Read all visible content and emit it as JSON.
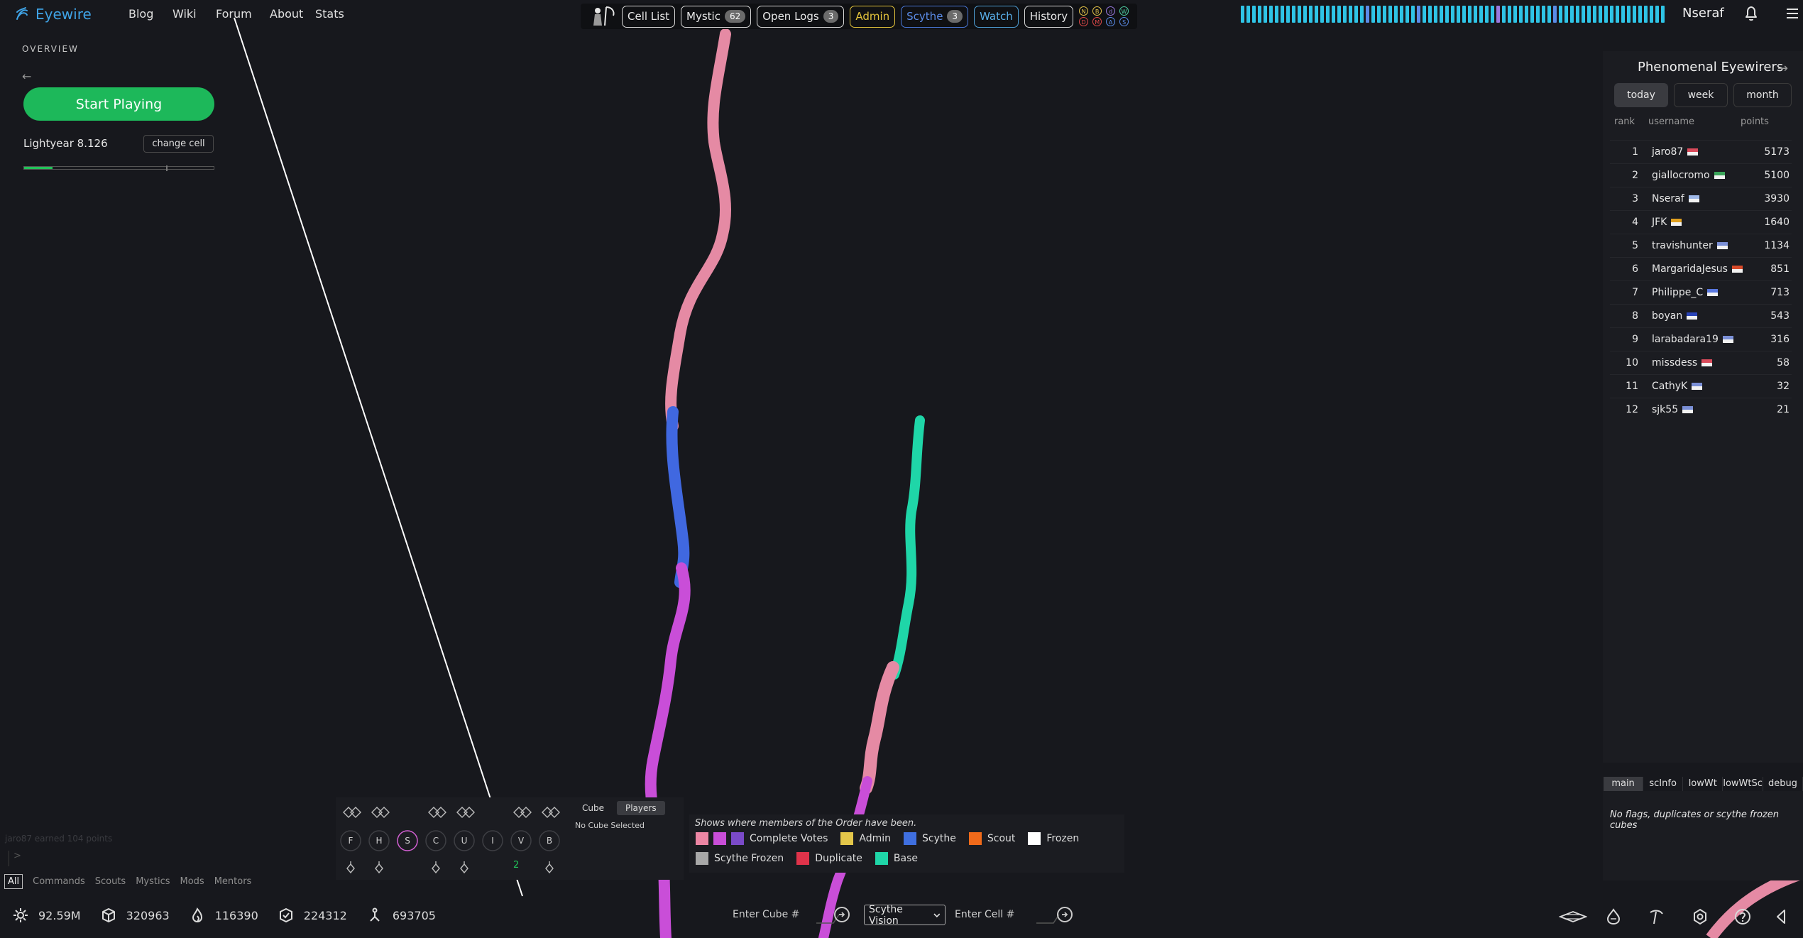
{
  "header": {
    "brand": "Eyewire",
    "nav": [
      "Blog",
      "Wiki",
      "Forum",
      "About",
      "Stats"
    ],
    "tools": {
      "cell_list": "Cell List",
      "mystic": "Mystic",
      "mystic_count": "62",
      "open_logs": "Open Logs",
      "open_logs_count": "3",
      "admin": "Admin",
      "scythe": "Scythe",
      "scythe_count": "3",
      "watch": "Watch",
      "history": "History"
    },
    "mini_flags": [
      {
        "letter": "N",
        "color": "#e8c64a"
      },
      {
        "letter": "B",
        "color": "#e8c64a"
      },
      {
        "letter": "d",
        "color": "#9a7ae0"
      },
      {
        "letter": "W",
        "color": "#4fd1a5"
      },
      {
        "letter": "D",
        "color": "#e04a4a"
      },
      {
        "letter": "M",
        "color": "#e04a4a"
      },
      {
        "letter": "A",
        "color": "#5b8ce8"
      },
      {
        "letter": "S",
        "color": "#5b8ce8"
      }
    ],
    "username": "Nseraf"
  },
  "overview": {
    "title": "OVERVIEW",
    "start_button": "Start Playing",
    "cell_name": "Lightyear 8.126",
    "change_cell": "change cell",
    "progress": 0.15
  },
  "chat": {
    "last_message": "jaro87 earned 104 points",
    "prompt": ">",
    "tabs": [
      "All",
      "Commands",
      "Scouts",
      "Mystics",
      "Mods",
      "Mentors"
    ]
  },
  "stats": {
    "points": "92.59M",
    "cubes": "320963",
    "trailblazes": "116390",
    "scythe_cubes": "224312",
    "players": "693705"
  },
  "toolbox": {
    "keys": [
      "F",
      "H",
      "S",
      "C",
      "U",
      "I",
      "V",
      "B"
    ],
    "active_key": "S",
    "digit": "2",
    "cube_tab": "Cube",
    "players_tab": "Players",
    "no_cube": "No Cube Selected"
  },
  "legend": {
    "title": "Shows where members of the Order have been.",
    "row1": [
      {
        "label": "Complete Votes",
        "colors": [
          "#ec86a4",
          "#c94ed8",
          "#7a4ac8"
        ]
      },
      {
        "label": "Admin",
        "colors": [
          "#e3c64a"
        ]
      },
      {
        "label": "Scythe",
        "colors": [
          "#3f6fe0"
        ]
      },
      {
        "label": "Scout",
        "colors": [
          "#f06a1a"
        ]
      },
      {
        "label": "Frozen",
        "colors": [
          "#ffffff"
        ]
      }
    ],
    "row2": [
      {
        "label": "Scythe Frozen",
        "colors": [
          "#a8a8a8"
        ]
      },
      {
        "label": "Duplicate",
        "colors": [
          "#e0334a"
        ]
      },
      {
        "label": "Base",
        "colors": [
          "#1fd6a8"
        ]
      }
    ]
  },
  "bottom_inputs": {
    "cube_placeholder": "Enter Cube #",
    "vision_select": "Scythe Vision",
    "cell_placeholder": "Enter Cell #"
  },
  "leaderboard": {
    "title": "Phenomenal Eyewirers",
    "ranges": [
      "today",
      "week",
      "month"
    ],
    "active_range": "today",
    "columns": [
      "rank",
      "username",
      "points"
    ],
    "rows": [
      {
        "rank": "1",
        "user": "jaro87",
        "points": "5173",
        "flag": "#d94b5b"
      },
      {
        "rank": "2",
        "user": "giallocromo",
        "points": "5100",
        "flag": "#3aa55a"
      },
      {
        "rank": "3",
        "user": "Nseraf",
        "points": "3930",
        "flag": "#9fb8e8"
      },
      {
        "rank": "4",
        "user": "JFK",
        "points": "1640",
        "flag": "#e0a020"
      },
      {
        "rank": "5",
        "user": "travishunter",
        "points": "1134",
        "flag": "#7a8fd6"
      },
      {
        "rank": "6",
        "user": "MargaridaJesus",
        "points": "851",
        "flag": "#d84a2a"
      },
      {
        "rank": "7",
        "user": "Philippe_C",
        "points": "713",
        "flag": "#5a78e0"
      },
      {
        "rank": "8",
        "user": "boyan",
        "points": "543",
        "flag": "#2a44b8"
      },
      {
        "rank": "9",
        "user": "larabadara19",
        "points": "316",
        "flag": "#7a8fd6"
      },
      {
        "rank": "10",
        "user": "missdess",
        "points": "58",
        "flag": "#d94b5b"
      },
      {
        "rank": "11",
        "user": "CathyK",
        "points": "32",
        "flag": "#7a8fd6"
      },
      {
        "rank": "12",
        "user": "sjk55",
        "points": "21",
        "flag": "#7a8fd6"
      }
    ]
  },
  "info": {
    "tabs": [
      "main",
      "scInfo",
      "lowWt",
      "lowWtSc",
      "debug"
    ],
    "active_tab": "main",
    "message": "No flags, duplicates or scythe frozen cubes"
  }
}
